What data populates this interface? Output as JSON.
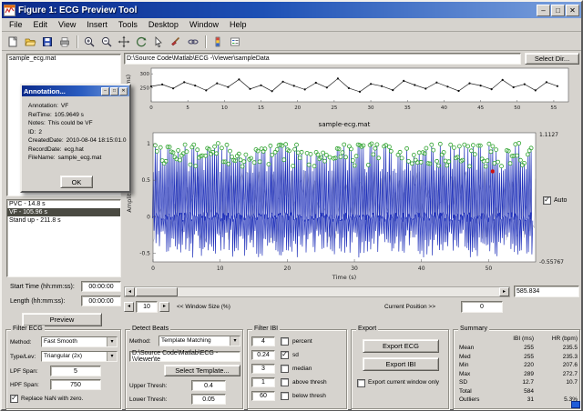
{
  "window": {
    "title": "Figure 1: ECG Preview Tool",
    "menus": [
      "File",
      "Edit",
      "View",
      "Insert",
      "Tools",
      "Desktop",
      "Window",
      "Help"
    ],
    "controls": {
      "minimize": "–",
      "maximize": "□",
      "close": "✕"
    }
  },
  "toolbar": {
    "buttons": [
      "new-figure",
      "open-file",
      "save-figure",
      "print-figure",
      "zoom-in",
      "zoom-out",
      "pan",
      "rotate-3d",
      "data-cursor",
      "brush",
      "link-plots",
      "insert-colorbar",
      "insert-legend"
    ]
  },
  "left": {
    "files": [
      "sample_ecg.mat"
    ],
    "annotations": [
      {
        "label": "PVC - 14.8 s",
        "selected": false
      },
      {
        "label": "VF - 105.96 s",
        "selected": true
      },
      {
        "label": "Stand up - 211.8 s",
        "selected": false
      }
    ],
    "start_label": "Start Time (hh:mm:ss):",
    "start_value": "00:00:00",
    "length_label": "Length (hh:mm:ss):",
    "length_value": "00:00:00",
    "preview_label": "Preview"
  },
  "dialog": {
    "title": "Annotation...",
    "fields": [
      {
        "k": "Annotation:",
        "v": "VF"
      },
      {
        "k": "RelTime:",
        "v": "105.9649 s"
      },
      {
        "k": "Notes:",
        "v": "This could be VF"
      },
      {
        "k": "ID:",
        "v": "2"
      },
      {
        "k": "CreatedDate:",
        "v": "2010-08-04 18:15:01.0"
      },
      {
        "k": "RecordDate:",
        "v": "ecg.hat"
      },
      {
        "k": "FileName:",
        "v": "sample_ecg.mat"
      }
    ],
    "ok_label": "OK"
  },
  "path_bar": {
    "value": "D:\\Source Code\\Matlab\\ECG -\\Viewer\\sampleData",
    "select_dir_label": "Select Dir..."
  },
  "viewer": {
    "scroll_value": "585.834",
    "window_size_label": "<< Window Size (%)",
    "window_size_value": "10",
    "position_label": "Current Position >>",
    "position_value": "0",
    "auto_label": "Auto",
    "auto_check": "✓"
  },
  "filter_ecg": {
    "title": "Filter ECG",
    "method_label": "Method:",
    "method_value": "Fast Smooth",
    "type_label": "Type/Lev:",
    "type_value": "Triangular (2x)",
    "lpf_label": "LPF Span:",
    "lpf_value": "5",
    "hpf_label": "HPF Span:",
    "hpf_value": "750",
    "nan_label": "Replace NaN with zero.",
    "nan_check": "✓"
  },
  "detect_beats": {
    "title": "Detect Beats",
    "method_label": "Method:",
    "method_value": "Template Matching",
    "template_path": "D:\\Source Code\\Matlab\\ECG -\\Viewer\\te",
    "select_template_label": "Select Template...",
    "upper_label": "Upper Thresh:",
    "upper_value": "0.4",
    "lower_label": "Lower Thresh:",
    "lower_value": "0.05"
  },
  "filter_ibi": {
    "title": "Filter IBI",
    "rows": [
      {
        "value": "4",
        "label": "percent",
        "check": ""
      },
      {
        "value": "0.24",
        "label": "sd",
        "check": "✓"
      },
      {
        "value": "3",
        "label": "median",
        "check": ""
      },
      {
        "value": "1",
        "label": "above thresh",
        "check": ""
      },
      {
        "value": "60",
        "label": "below thresh",
        "check": ""
      }
    ]
  },
  "export": {
    "title": "Export",
    "ecg_label": "Export ECG",
    "ibi_label": "Export IBI",
    "window_only_label": "Export current window only",
    "window_only_check": ""
  },
  "summary": {
    "title": "Summary",
    "col_ibi": "IBI (ms)",
    "col_hr": "HR (bpm)",
    "rows": [
      {
        "label": "Mean",
        "ibi": "255",
        "hr": "235.5"
      },
      {
        "label": "Med",
        "ibi": "255",
        "hr": "235.3"
      },
      {
        "label": "Min",
        "ibi": "220",
        "hr": "207.6"
      },
      {
        "label": "Max",
        "ibi": "289",
        "hr": "272.7"
      },
      {
        "label": "SD",
        "ibi": "12.7",
        "hr": "10.7"
      },
      {
        "label": "Total",
        "ibi": "584",
        "hr": ""
      },
      {
        "label": "Outliers",
        "ibi": "31",
        "hr": "5.3%"
      }
    ]
  },
  "chart_data": [
    {
      "type": "line",
      "name": "ibi-trend",
      "title": "",
      "xlabel": "",
      "ylabel": "IBI (ms)",
      "legend": "none",
      "grid": false,
      "x_ticks": [
        0,
        5,
        10,
        15,
        20,
        25,
        30,
        35,
        40,
        45,
        50,
        55
      ],
      "y_ticks": [
        250,
        300
      ],
      "xlim": [
        0,
        57
      ],
      "ylim": [
        200,
        320
      ],
      "x": [
        0,
        1.5,
        3,
        4.5,
        6,
        7.5,
        9,
        10.5,
        12,
        13.5,
        15,
        16.5,
        18,
        19.5,
        21,
        22.5,
        24,
        25.5,
        27,
        28.5,
        30,
        31.5,
        33,
        34.5,
        36,
        37.5,
        39,
        40.5,
        42,
        43.5,
        45,
        46.5,
        48,
        49.5,
        51,
        52.5,
        54,
        55.5
      ],
      "y": [
        255,
        262,
        248,
        270,
        258,
        241,
        266,
        253,
        280,
        246,
        259,
        238,
        272,
        257,
        244,
        268,
        251,
        283,
        249,
        236,
        264,
        256,
        242,
        275,
        260,
        247,
        269,
        254,
        239,
        266,
        258,
        245,
        278,
        252,
        263,
        241,
        270,
        256
      ],
      "line_color": "#222222",
      "marker_color": "#111111"
    },
    {
      "type": "line",
      "name": "ecg-waveform",
      "title": "sample-ecg.mat",
      "xlabel": "Time (s)",
      "ylabel": "Amplitude",
      "legend": "none",
      "grid": false,
      "x_ticks": [
        0,
        10,
        20,
        30,
        40,
        50
      ],
      "y_ticks": [
        1,
        0.5,
        0,
        -0.5
      ],
      "xlim": [
        0,
        57
      ],
      "ylim": [
        -0.62,
        1.15
      ],
      "ymax_label": "1.1127",
      "ymin_label": "-0.55767",
      "synth": {
        "seed": 7,
        "t_start": 0.12,
        "t_end": 56.5,
        "ibi_base": 0.235,
        "ibi_jitter": 0.05,
        "peak_min": 0.6,
        "peak_range": 0.38,
        "trough_min": 0.18,
        "trough_range": 0.38
      },
      "outlier": {
        "t": 50.6,
        "amp": 0.62
      },
      "colors": {
        "trace": "#2233bb",
        "beat_marker": "#2fa32f",
        "outlier": "#cc1111",
        "noise": "#b9bac4"
      }
    }
  ]
}
